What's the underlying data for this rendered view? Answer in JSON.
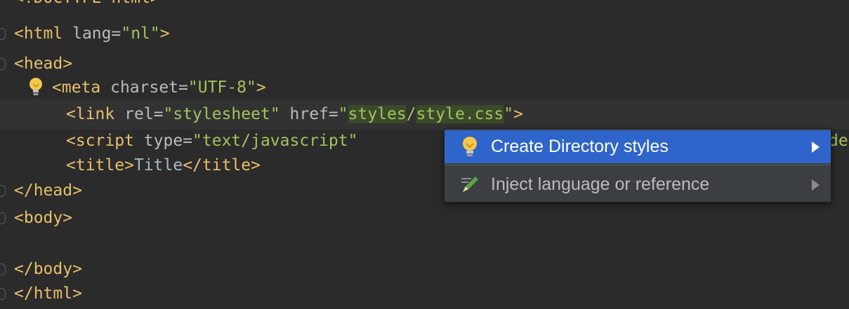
{
  "editor": {
    "lines": [
      {
        "kind": "partial",
        "text": "<!DOCTYPE html>"
      },
      {
        "kind": "html"
      },
      {
        "kind": "head"
      },
      {
        "kind": "meta"
      },
      {
        "kind": "link"
      },
      {
        "kind": "script"
      },
      {
        "kind": "title"
      },
      {
        "kind": "head_close"
      },
      {
        "kind": "body"
      },
      {
        "kind": "empty"
      },
      {
        "kind": "body_close"
      },
      {
        "kind": "html_close"
      }
    ],
    "tokens": {
      "html_open": "<html",
      "lang_attr": " lang=",
      "lang_val": "\"nl\"",
      "gt": ">",
      "head_open": "<head>",
      "meta_open": "<meta",
      "charset_attr": " charset=",
      "charset_val": "\"UTF-8\"",
      "link_open": "<link",
      "rel_attr": " rel=",
      "rel_val": "\"stylesheet\"",
      "href_attr": " href=",
      "quote": "\"",
      "href_part1": "styles",
      "slash": "/",
      "href_part2": "style.css",
      "script_open": "<script",
      "type_attr": " type=",
      "type_val": "\"text/javascript\"",
      "script_tail": "de",
      "title_open": "<title>",
      "title_text": "Title",
      "title_close": "</title>",
      "head_close": "</head>",
      "body_open": "<body>",
      "body_close": "</body>",
      "html_close": "</html>"
    }
  },
  "intention_popup": {
    "items": [
      {
        "label": "Create Directory styles",
        "icon": "lightbulb-icon",
        "selected": true
      },
      {
        "label": "Inject language or reference",
        "icon": "pencil-icon",
        "selected": false
      }
    ]
  },
  "colors": {
    "background": "#2b2b2b",
    "tag": "#e8bf6a",
    "attribute": "#bababa",
    "string": "#a5c25c",
    "selection": "#2f65ca",
    "popup": "#3c3f41"
  }
}
